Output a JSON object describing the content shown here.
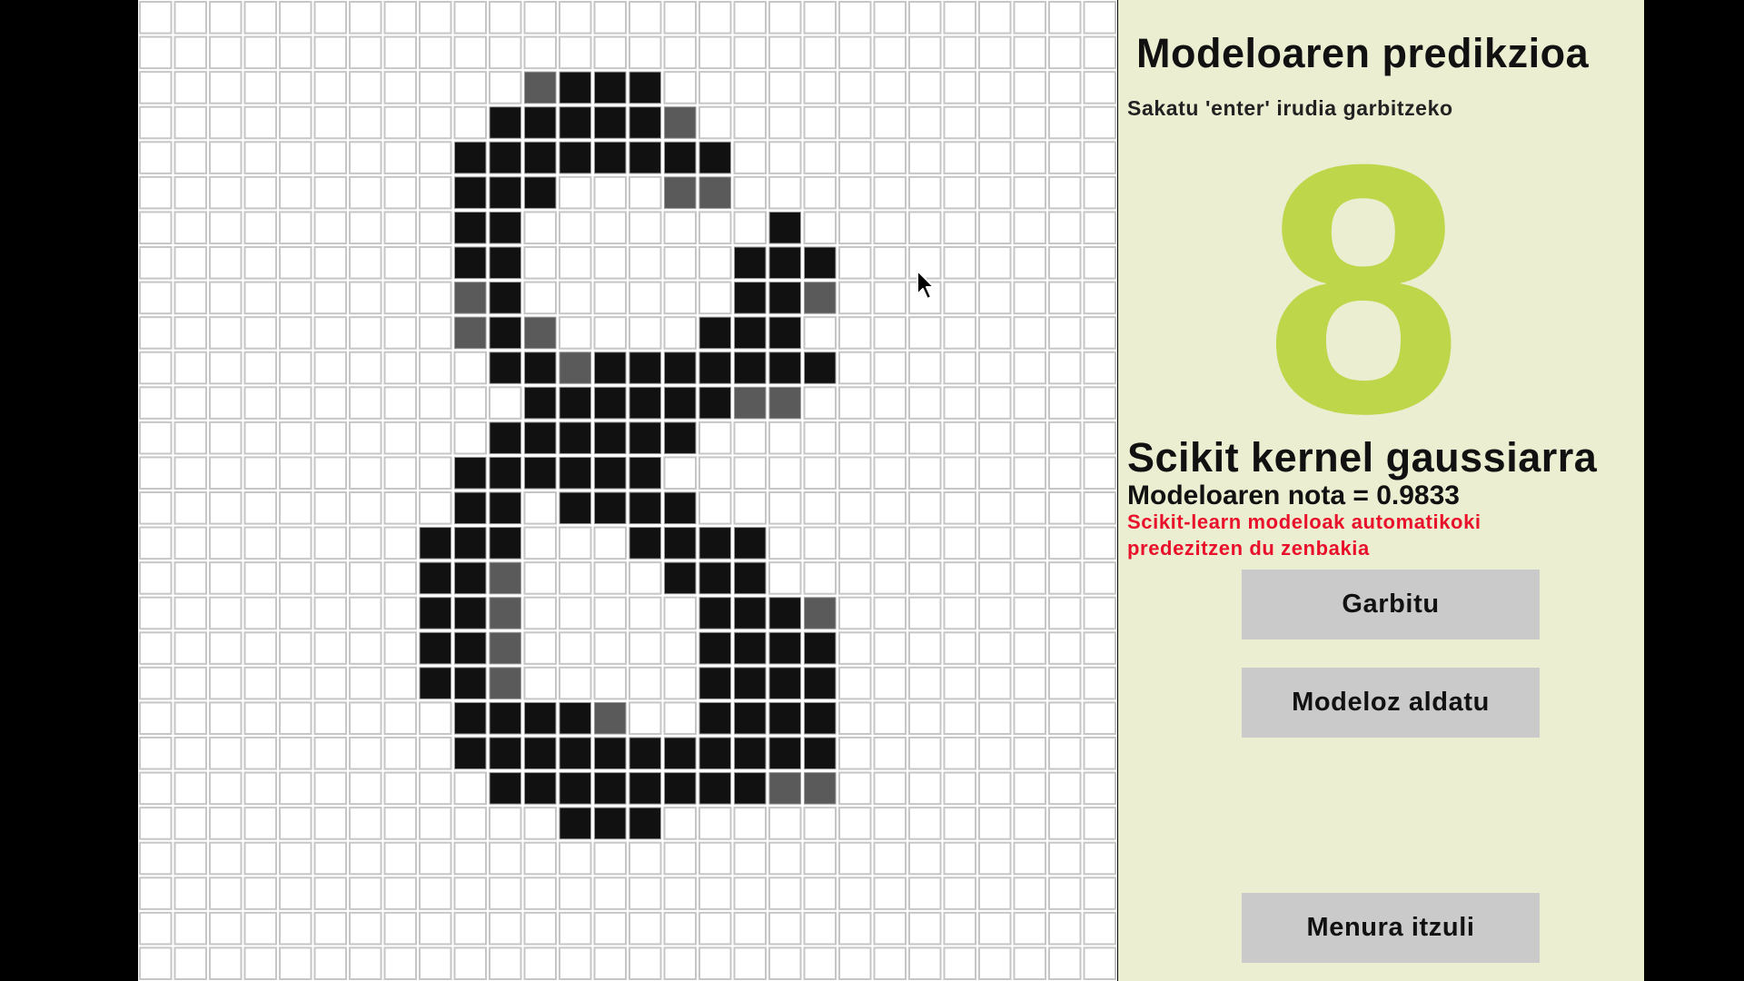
{
  "canvas": {
    "grid_rows": 28,
    "grid_cols": 28,
    "background": "#ffffff",
    "grid_line_color": "#c6c6c6",
    "pixels": [
      "............................",
      "............................",
      "...........2333.............",
      "..........333332............",
      ".........33333333...........",
      ".........333...22...........",
      ".........33.......3.........",
      ".........33......333........",
      ".........23......332........",
      ".........232....333.........",
      "..........3323333333........",
      "...........33333322.........",
      "..........333333............",
      ".........333333.............",
      ".........33.3333............",
      "........333...3333..........",
      "........332....333..........",
      "........332.....3332........",
      "........332.....3333........",
      "........332.....3333........",
      ".........33332..3333........",
      ".........33333333333........",
      "..........3333333322........",
      "............333.............",
      "............................",
      "............................",
      "............................",
      "............................"
    ],
    "shade_colors": {
      "2": "#5a5a5a",
      "3": "#111111"
    },
    "cursor": "arrow-cursor"
  },
  "panel": {
    "background": "#eceed2",
    "title": "Modeloaren predikzioa",
    "hint": "Sakatu 'enter' irudia garbitzeko",
    "prediction": "8",
    "prediction_color": "#bed64a",
    "model_name": "Scikit kernel gaussiarra",
    "score_text": "Modeloaren nota = 0.9833",
    "note_line1": "Scikit-learn modeloak automatikoki",
    "note_line2": "predezitzen du zenbakia",
    "note_color": "#e8102a",
    "buttons": {
      "clear": "Garbitu",
      "change_model": "Modeloz aldatu",
      "back_to_menu": "Menura itzuli"
    },
    "button_color": "#cacaca"
  }
}
